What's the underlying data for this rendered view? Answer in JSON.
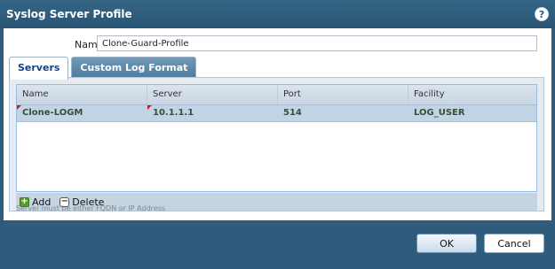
{
  "dialog": {
    "title": "Syslog Server Profile",
    "help_icon_glyph": "?"
  },
  "name_field": {
    "label": "Name",
    "value": "Clone-Guard-Profile"
  },
  "tabs": [
    {
      "label": "Servers",
      "active": true
    },
    {
      "label": "Custom Log Format",
      "active": false
    }
  ],
  "grid": {
    "columns": [
      "Name",
      "Server",
      "Port",
      "Facility"
    ],
    "rows": [
      {
        "name": "Clone-LOGM",
        "server": "10.1.1.1",
        "port": "514",
        "facility": "LOG_USER"
      }
    ]
  },
  "toolbar": {
    "add_label": "Add",
    "delete_label": "Delete"
  },
  "hint": "Server must be either FQDN or IP Address",
  "buttons": {
    "ok": "OK",
    "cancel": "Cancel"
  },
  "colors": {
    "dialog_bg": "#2f5c7c",
    "selected_row": "#c0d4e6",
    "dirty_marker": "#dd1122"
  }
}
